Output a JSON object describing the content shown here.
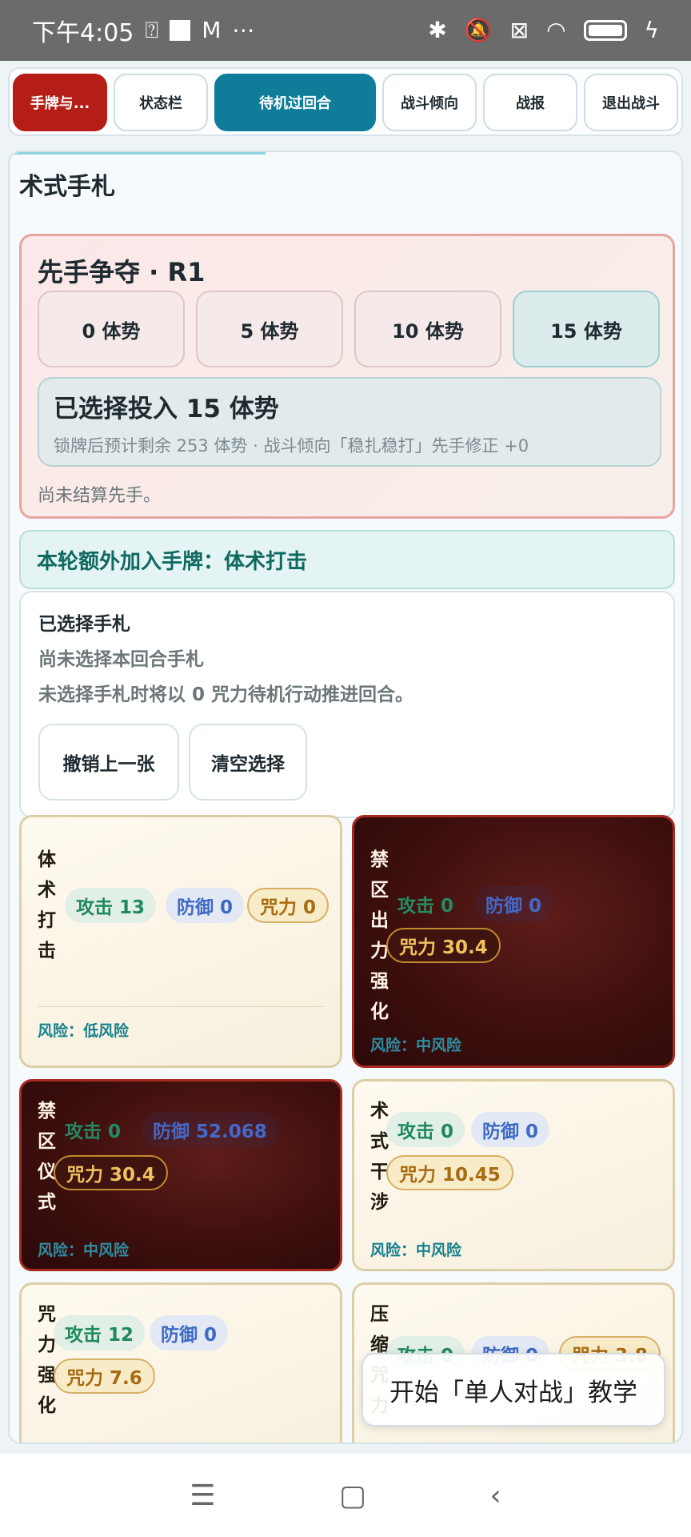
{
  "status_bar": {
    "time": "下午4:05",
    "extra_icons": "⋯",
    "m_icon": "M"
  },
  "tabs": [
    {
      "label": "手牌与..."
    },
    {
      "label": "状态栏"
    },
    {
      "label": "待机过回合"
    },
    {
      "label": "战斗倾向"
    },
    {
      "label": "战报"
    },
    {
      "label": "退出战斗"
    }
  ],
  "panel": {
    "title": "术式手札"
  },
  "initiative": {
    "title": "先手争夺 · R1",
    "options": [
      "0 体势",
      "5 体势",
      "10 体势",
      "15 体势"
    ],
    "selected_index": 3,
    "chosen_main": "已选择投入 15 体势",
    "chosen_sub": "锁牌后预计剩余 253 体势 · 战斗倾向「稳扎稳打」先手修正 +0",
    "status": "尚未结算先手。"
  },
  "notice": "本轮额外加入手牌：体术打击",
  "selected_hand": {
    "heading": "已选择手札",
    "line1": "尚未选择本回合手札",
    "line2": "未选择手札时将以 0 咒力待机行动推进回合。",
    "undo_label": "撤销上一张",
    "clear_label": "清空选择"
  },
  "cards": [
    {
      "name": "体术打击",
      "atk": "攻击 13",
      "def": "防御 0",
      "mana": "咒力 0",
      "risk": "风险：低风险",
      "style": "light"
    },
    {
      "name": "禁区出力强化",
      "atk": "攻击 0",
      "def": "防御 0",
      "mana": "咒力 30.4",
      "risk": "风险：中风险",
      "style": "dark"
    },
    {
      "name": "禁区仪式",
      "atk": "攻击 0",
      "def": "防御 52.068",
      "mana": "咒力 30.4",
      "risk": "风险：中风险",
      "style": "dark"
    },
    {
      "name": "术式干涉",
      "atk": "攻击 0",
      "def": "防御 0",
      "mana": "咒力 10.45",
      "risk": "风险：中风险",
      "style": "light"
    },
    {
      "name": "咒力强化",
      "atk": "攻击 12",
      "def": "防御 0",
      "mana": "咒力 7.6",
      "risk": "",
      "style": "light"
    },
    {
      "name": "压缩咒力",
      "atk": "攻击 0",
      "def": "防御 0",
      "mana": "咒力 3.8",
      "risk": "",
      "style": "light"
    }
  ],
  "tutorial": "开始「单人对战」教学",
  "colors": {
    "accent_red": "#b51e17",
    "accent_teal": "#0f7d99",
    "risk_teal": "#17808c"
  }
}
